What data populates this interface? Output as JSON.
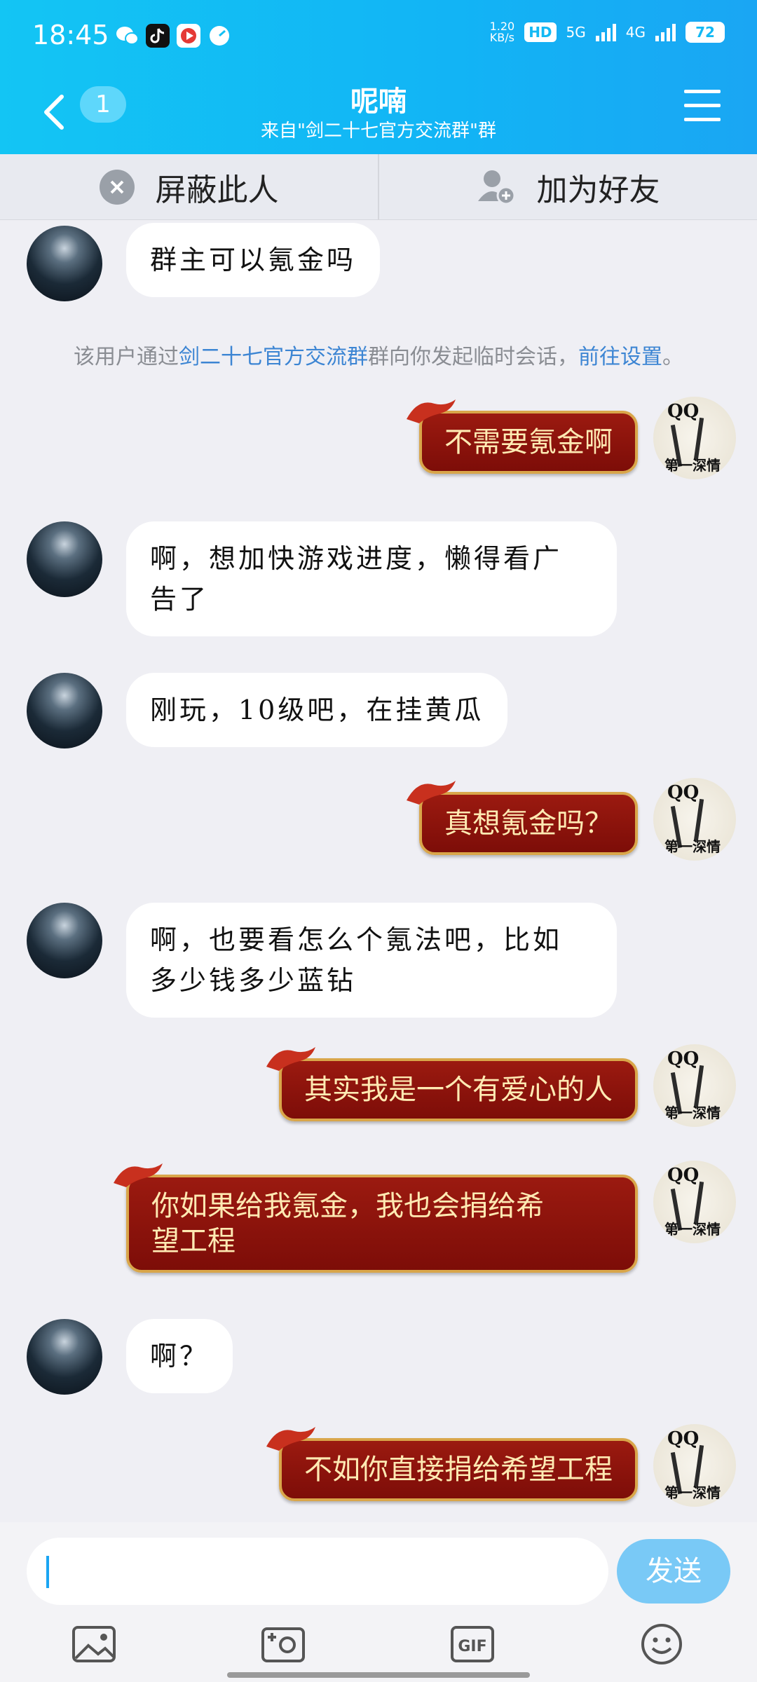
{
  "status_bar": {
    "time": "18:45",
    "net_speed_top": "1.20",
    "net_speed_bottom": "KB/s",
    "hd_label": "HD",
    "sim1": "5G",
    "sim2": "4G",
    "battery": "72"
  },
  "header": {
    "title": "呢喃",
    "subtitle": "来自\"剑二十七官方交流群\"群",
    "unread_count": "1"
  },
  "actions": {
    "block_label": "屏蔽此人",
    "add_friend_label": "加为好友"
  },
  "notice": {
    "prefix": "该用户通过",
    "group_link": "剑二十七官方交流群",
    "middle": "群向你发起临时会话，",
    "settings_link": "前往设置",
    "suffix": "。"
  },
  "messages": [
    {
      "side": "left",
      "text": "群主可以氪金吗"
    },
    {
      "side": "right",
      "text": "不需要氪金啊"
    },
    {
      "side": "left",
      "text_line1": "啊，想加快游戏进度，懒得看广",
      "text_line2": "告了"
    },
    {
      "side": "left",
      "text": "刚玩，10级吧，在挂黄瓜"
    },
    {
      "side": "right",
      "text": "真想氪金吗？"
    },
    {
      "side": "left",
      "text_line1": "啊，也要看怎么个氪法吧，比如",
      "text_line2": "多少钱多少蓝钻"
    },
    {
      "side": "right",
      "text": "其实我是一个有爱心的人"
    },
    {
      "side": "right",
      "text_line1": "你如果给我氪金，我也会捐给希",
      "text_line2": "望工程"
    },
    {
      "side": "left",
      "text": "啊？"
    },
    {
      "side": "right",
      "text": "不如你直接捐给希望工程"
    }
  ],
  "my_avatar": {
    "top": "QQ",
    "caption": "第一深情"
  },
  "input": {
    "send_label": "发送"
  },
  "colors": {
    "header": "#13c5f4",
    "bubble_right": "#8a140c",
    "bubble_right_border": "#d9a64a",
    "send_button": "#79c9f6",
    "link": "#3c85d3"
  }
}
